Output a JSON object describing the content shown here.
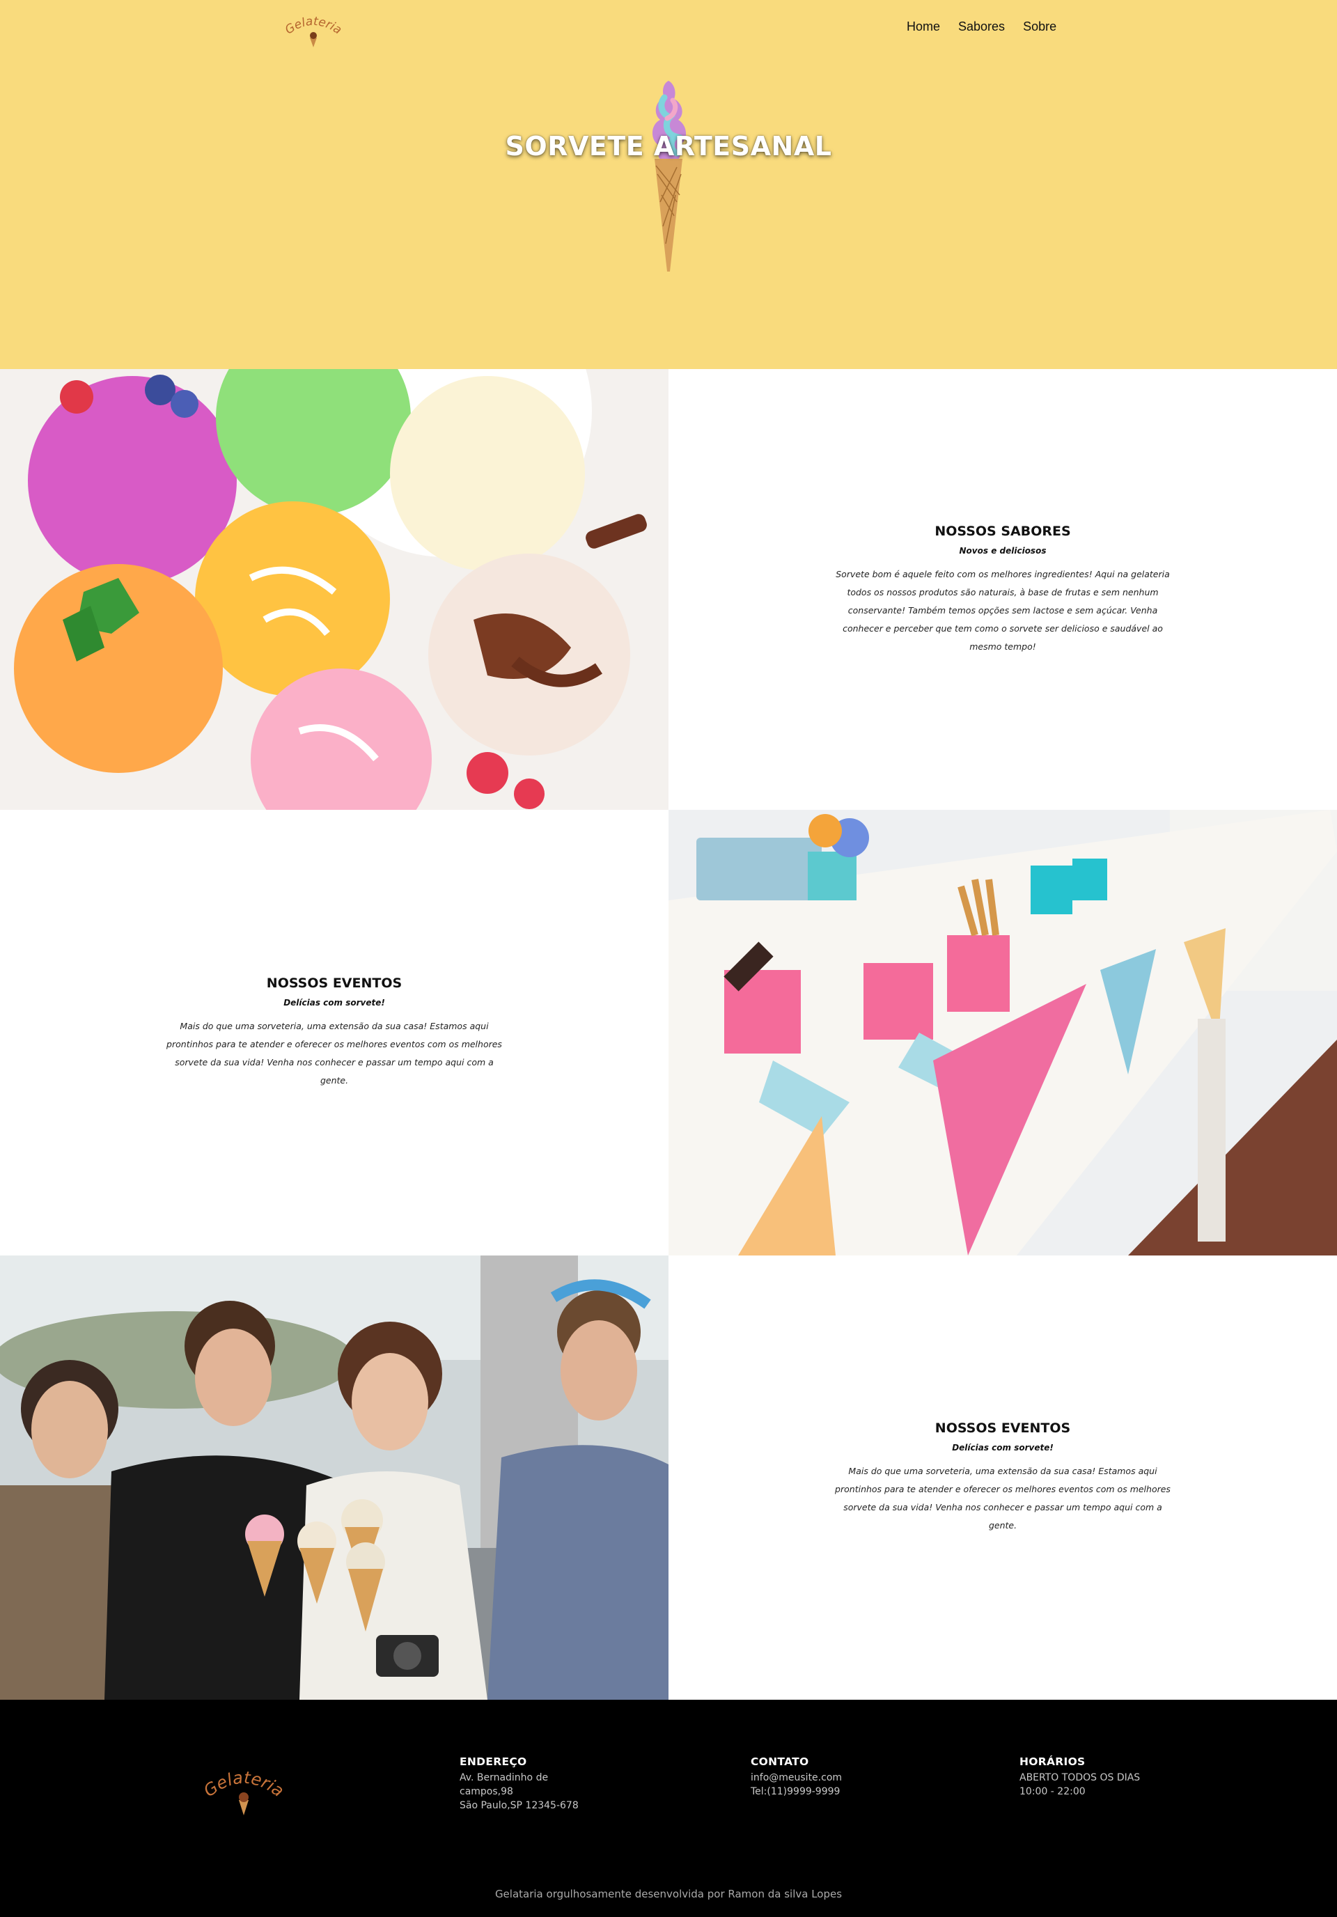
{
  "header": {
    "logo_text": "Gelateria",
    "nav": [
      "Home",
      "Sabores",
      "Sobre"
    ]
  },
  "hero": {
    "title": "SORVETE ARTESANAL"
  },
  "sections": [
    {
      "title": "NOSSOS SABORES",
      "subtitle": "Novos e deliciosos",
      "text": "Sorvete bom é aquele feito com os melhores ingredientes! Aqui na gelateria todos os nossos produtos são naturais, à base de frutas e sem nenhum conservante! Também temos opções sem lactose e sem açúcar. Venha conhecer e perceber que tem como o sorvete ser delicioso e saudável ao mesmo tempo!"
    },
    {
      "title": "NOSSOS EVENTOS",
      "subtitle": "Delícias com sorvete!",
      "text": "Mais do que uma sorveteria, uma extensão da sua casa! Estamos aqui prontinhos para te atender e oferecer os melhores eventos com os melhores sorvete da sua vida! Venha nos conhecer e passar um tempo aqui com a gente."
    },
    {
      "title": "NOSSOS EVENTOS",
      "subtitle": "Delícias com sorvete!",
      "text": "Mais do que uma sorveteria, uma extensão da sua casa! Estamos aqui prontinhos para te atender e oferecer os melhores eventos com os melhores sorvete da sua vida! Venha nos conhecer e passar um tempo aqui com a gente."
    }
  ],
  "footer": {
    "logo_text": "Gelateria",
    "address": {
      "title": "ENDEREÇO",
      "line1": "Av. Bernadinho de",
      "line2": "campos,98",
      "line3": "São Paulo,SP 12345-678"
    },
    "contact": {
      "title": "CONTATO",
      "email": "info@meusite.com",
      "phone": "Tel:(11)9999-9999"
    },
    "hours": {
      "title": "HORÁRIOS",
      "line1": "ABERTO TODOS OS DIAS",
      "line2": "10:00 - 22:00"
    },
    "credit": "Gelataria orgulhosamente desenvolvida por Ramon da silva Lopes"
  },
  "colors": {
    "hero_bg": "#f9db7d",
    "footer_bg": "#000000",
    "logo_brown": "#b5652e"
  }
}
